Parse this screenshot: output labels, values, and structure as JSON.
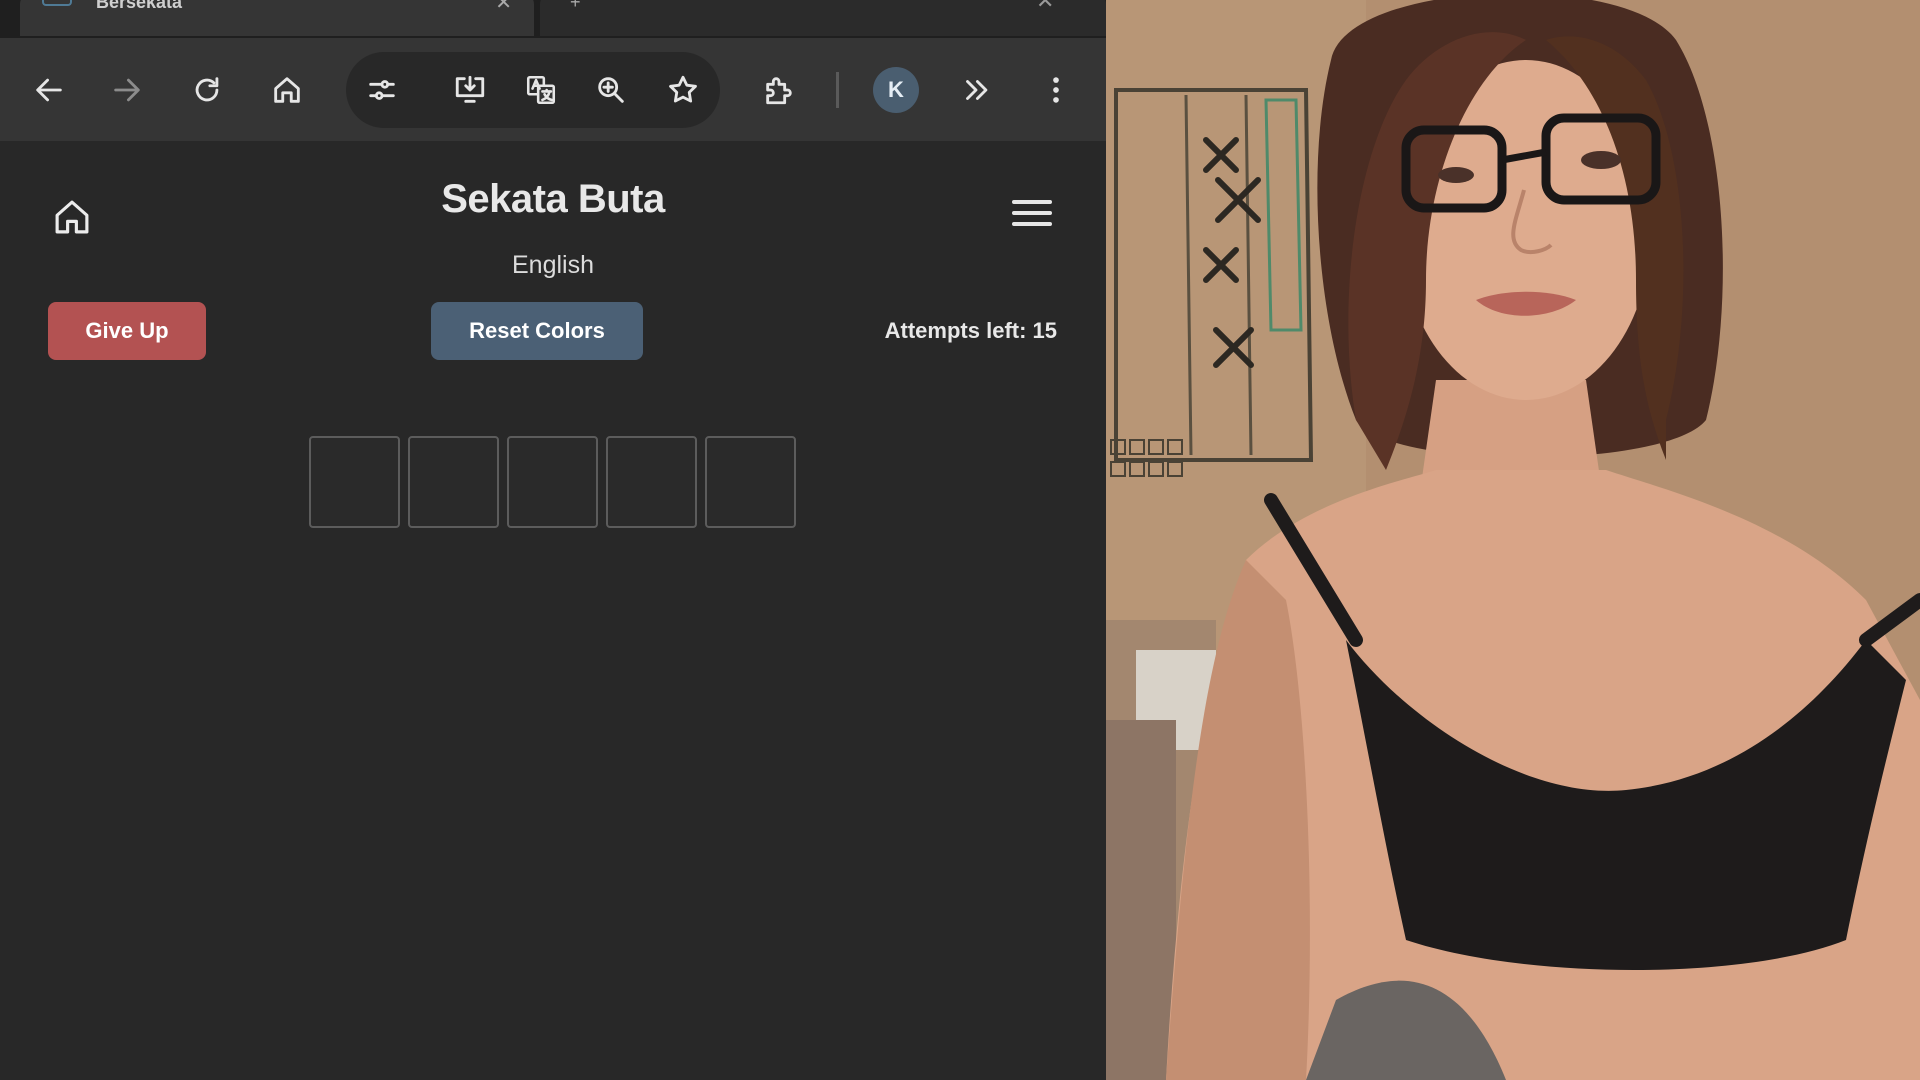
{
  "browser": {
    "tab": {
      "title": "Bersekata"
    },
    "profile": {
      "initial": "K"
    },
    "toolbar_icons": [
      "back-icon",
      "forward-icon",
      "reload-icon",
      "home-icon",
      "site-settings-icon",
      "install-app-icon",
      "translate-icon",
      "zoom-icon",
      "bookmark-star-icon",
      "extensions-icon",
      "more-extensions-icon",
      "kebab-menu-icon"
    ]
  },
  "page": {
    "title": "Sekata Buta",
    "language": "English",
    "give_up_label": "Give Up",
    "reset_colors_label": "Reset Colors",
    "attempts_text": "Attempts left: 15",
    "guess_letters": [
      "",
      "",
      "",
      "",
      ""
    ]
  },
  "colors": {
    "page_background": "#282828",
    "give_up": "#b35252",
    "reset_colors": "#4b6075",
    "toolbar": "#353535"
  },
  "webcam": {
    "content": "webcam-feed"
  }
}
